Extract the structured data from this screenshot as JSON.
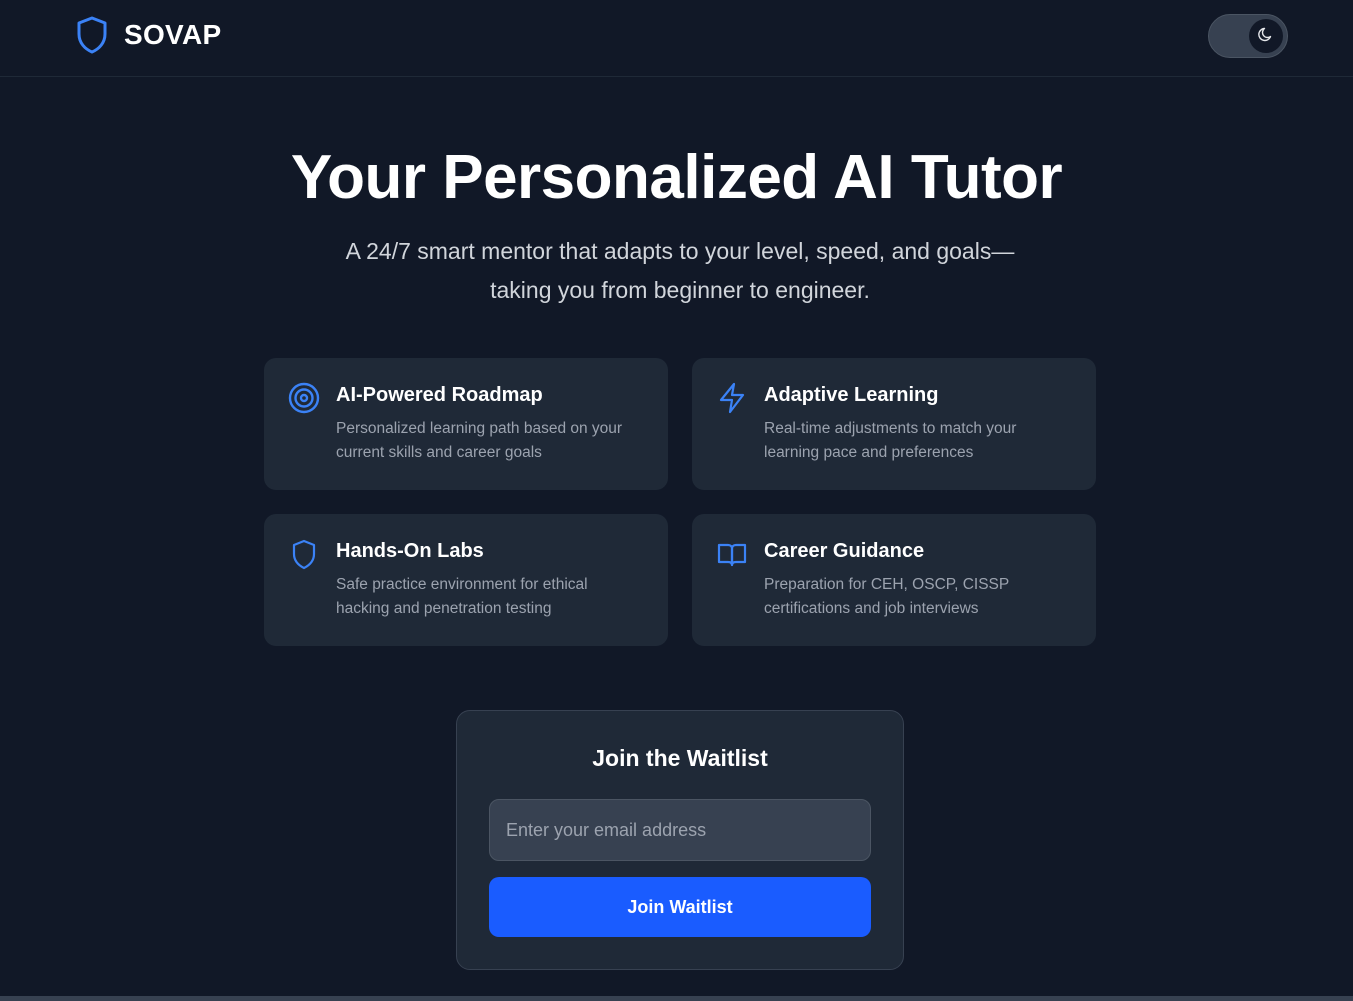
{
  "header": {
    "brand": "SOVAP",
    "logo_icon": "shield-icon",
    "theme_toggle_icon": "moon-icon"
  },
  "hero": {
    "title": "Your Personalized AI Tutor",
    "subtitle_line1": "A 24/7 smart mentor that adapts to your level, speed, and goals—",
    "subtitle_line2": "taking you from beginner to engineer."
  },
  "features": [
    {
      "icon": "target-icon",
      "title": "AI-Powered Roadmap",
      "desc_line1": "Personalized learning path based on your",
      "desc_line2": "current skills and career goals"
    },
    {
      "icon": "lightning-icon",
      "title": "Adaptive Learning",
      "desc_line1": "Real-time adjustments to match your",
      "desc_line2": "learning pace and preferences"
    },
    {
      "icon": "shield-icon",
      "title": "Hands-On Labs",
      "desc_line1": "Safe practice environment for ethical",
      "desc_line2": "hacking and penetration testing"
    },
    {
      "icon": "book-open-icon",
      "title": "Career Guidance",
      "desc_line1": "Preparation for CEH, OSCP, CISSP",
      "desc_line2": "certifications and job interviews"
    }
  ],
  "waitlist": {
    "title": "Join the Waitlist",
    "email_placeholder": "Enter your email address",
    "email_value": "",
    "button_label": "Join Waitlist"
  },
  "colors": {
    "background": "#111827",
    "card": "#1f2937",
    "accent_icon": "#3b82f6",
    "button": "#1a5cff",
    "muted_text": "#9ca3af"
  }
}
